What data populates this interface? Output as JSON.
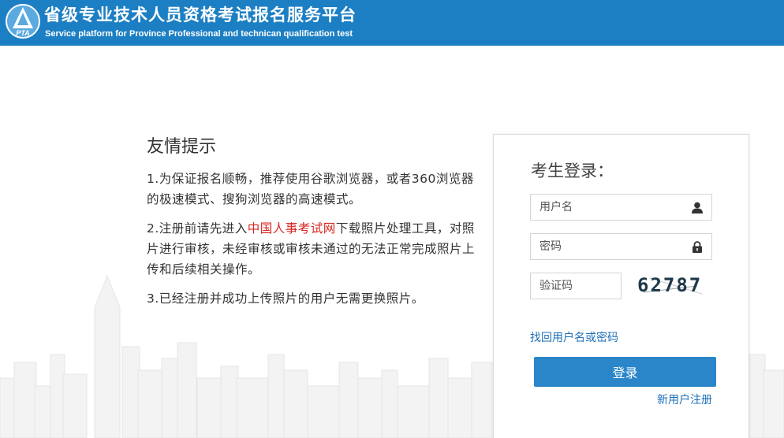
{
  "header": {
    "title_cn": "省级专业技术人员资格考试报名服务平台",
    "title_en": "Service platform for Province Professional and technican qualification test",
    "logo_text": "PTA"
  },
  "notice": {
    "title": "友情提示",
    "item1": "1.为保证报名顺畅，推荐使用谷歌浏览器，或者360浏览器的极速模式、搜狗浏览器的高速模式。",
    "item2_prefix": "2.注册前请先进入",
    "item2_link": "中国人事考试网",
    "item2_suffix": "下载照片处理工具，对照片进行审核，未经审核或审核未通过的无法正常完成照片上传和后续相关操作。",
    "item3": "3.已经注册并成功上传照片的用户无需更换照片。"
  },
  "login": {
    "title": "考生登录：",
    "username_placeholder": "用户名",
    "password_placeholder": "密码",
    "code_placeholder": "验证码",
    "captcha_text": "62787",
    "forgot_link": "找回用户名或密码",
    "login_button": "登录",
    "register_link": "新用户注册"
  },
  "icons": {
    "logo": "pta-logo-icon",
    "user": "user-icon",
    "lock": "lock-icon"
  },
  "colors": {
    "header_bg": "#1d7fc3",
    "button_bg": "#2a86c9",
    "link_blue": "#1d6fb8",
    "link_red": "#d8261f"
  }
}
